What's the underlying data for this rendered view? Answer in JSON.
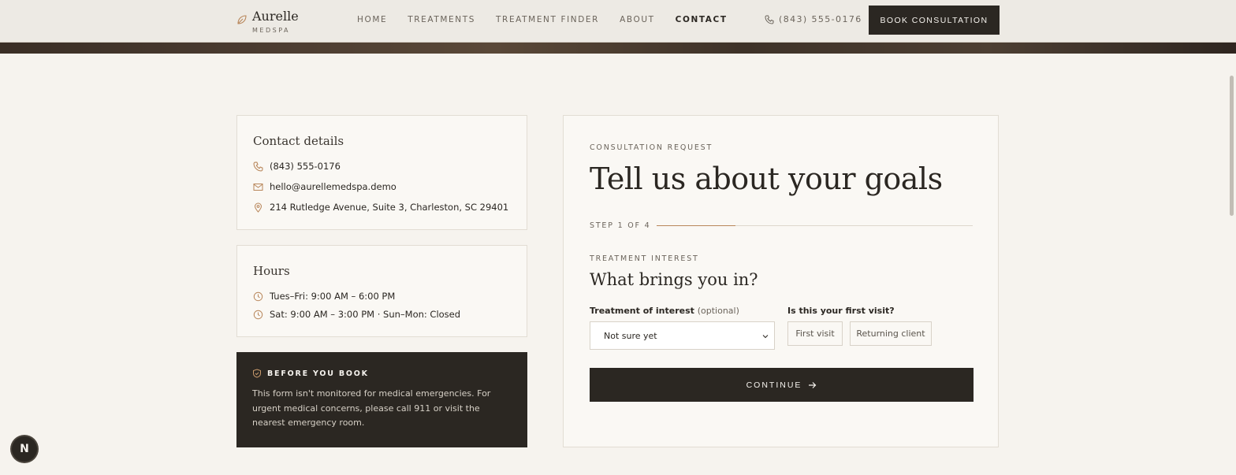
{
  "brand": {
    "name": "Aurelle",
    "sub": "MEDSPA"
  },
  "nav": {
    "items": [
      "HOME",
      "TREATMENTS",
      "TREATMENT FINDER",
      "ABOUT",
      "CONTACT"
    ],
    "active": "CONTACT"
  },
  "header": {
    "phone": "(843) 555-0176",
    "cta": "BOOK CONSULTATION"
  },
  "contact": {
    "title": "Contact details",
    "phone": "(843) 555-0176",
    "email": "hello@aurellemedspa.demo",
    "address": "214 Rutledge Avenue, Suite 3, Charleston, SC 29401"
  },
  "hours": {
    "title": "Hours",
    "line1": "Tues–Fri: 9:00 AM – 6:00 PM",
    "line2": "Sat: 9:00 AM – 3:00 PM · Sun–Mon: Closed"
  },
  "notice": {
    "title": "BEFORE YOU BOOK",
    "text": "This form isn't monitored for medical emergencies. For urgent medical concerns, please call 911 or visit the nearest emergency room."
  },
  "form": {
    "eyebrow": "CONSULTATION REQUEST",
    "title": "Tell us about your goals",
    "step": "STEP 1 OF 4",
    "progress": 0.25,
    "section_eyebrow": "TREATMENT INTEREST",
    "section_title": "What brings you in?",
    "treatment_label": "Treatment of interest",
    "treatment_optional": "(optional)",
    "treatment_value": "Not sure yet",
    "visit_label": "Is this your first visit?",
    "visit_first": "First visit",
    "visit_returning": "Returning client",
    "continue": "CONTINUE"
  },
  "badge": "N",
  "colors": {
    "dark": "#2b2722",
    "accent": "#b8865a",
    "background": "#f6f3ee"
  }
}
